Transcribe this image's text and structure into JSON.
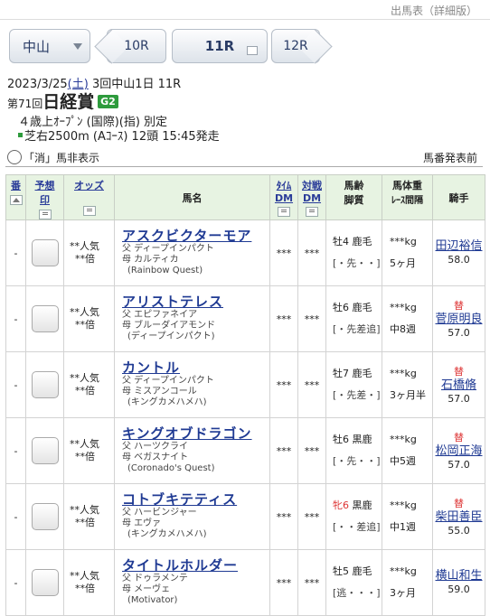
{
  "header": {
    "title": "出馬表（詳細版）"
  },
  "nav": {
    "venue": "中山",
    "prev": "10R",
    "current": "11R",
    "next": "12R"
  },
  "race": {
    "date": "2023/3/25",
    "weekday": "(土)",
    "meeting": " 3回中山1日 11R",
    "number_label": "第71回",
    "name": "日経賞",
    "grade": "G2",
    "conditions": "４歳上ｵｰﾌﾟﾝ (国際)(指) 別定",
    "course": "芝右2500m (Aｺｰｽ) 12頭 15:45発走"
  },
  "controls": {
    "hide_label": "「消」馬非表示",
    "status": "馬番発表前"
  },
  "table": {
    "headers": {
      "ban": "番",
      "mark_a": "予想",
      "mark_b": "印",
      "odds": "オッズ",
      "name": "馬名",
      "time_a": "ﾀｲﾑ",
      "time_b": "DM",
      "vs_a": "対戦",
      "vs_b": "DM",
      "age_a": "馬齢",
      "age_b": "脚質",
      "wt_a": "馬体重",
      "wt_b": "ﾚｰｽ間隔",
      "jockey": "騎手"
    },
    "rows": [
      {
        "ban": "-",
        "odds1": "**人気",
        "odds2": "**倍",
        "name": "アスクビクターモア",
        "sire": "父 ディープインパクト",
        "dam": "母 カルティカ",
        "damsire": "(Rainbow Quest)",
        "tdm": "***",
        "vdm": "***",
        "sex": "牡4",
        "coat": " 鹿毛",
        "style": "[・先・・]",
        "weight": "***kg",
        "interval": "5ヶ月",
        "change": "",
        "jockey": "田辺裕信",
        "jweight": "58.0"
      },
      {
        "ban": "-",
        "odds1": "**人気",
        "odds2": "**倍",
        "name": "アリストテレス",
        "sire": "父 エピファネイア",
        "dam": "母 ブルーダイアモンド",
        "damsire": "(ディープインパクト)",
        "tdm": "***",
        "vdm": "***",
        "sex": "牡6",
        "coat": " 鹿毛",
        "style": "[・先差追]",
        "weight": "***kg",
        "interval": "中8週",
        "change": "替",
        "jockey": "菅原明良",
        "jweight": "57.0"
      },
      {
        "ban": "-",
        "odds1": "**人気",
        "odds2": "**倍",
        "name": "カントル",
        "sire": "父 ディープインパクト",
        "dam": "母 ミスアンコール",
        "damsire": "(キングカメハメハ)",
        "tdm": "***",
        "vdm": "***",
        "sex": "牡7",
        "coat": " 鹿毛",
        "style": "[・先差・]",
        "weight": "***kg",
        "interval": "3ヶ月半",
        "change": "替",
        "jockey": "石橋脩",
        "jweight": "57.0"
      },
      {
        "ban": "-",
        "odds1": "**人気",
        "odds2": "**倍",
        "name": "キングオブドラゴン",
        "sire": "父 ハーツクライ",
        "dam": "母 ベガスナイト",
        "damsire": "(Coronado's Quest)",
        "tdm": "***",
        "vdm": "***",
        "sex": "牡6",
        "coat": " 黒鹿",
        "style": "[・先・・]",
        "weight": "***kg",
        "interval": "中5週",
        "change": "替",
        "jockey": "松岡正海",
        "jweight": "57.0"
      },
      {
        "ban": "-",
        "odds1": "**人気",
        "odds2": "**倍",
        "name": "コトブキテティス",
        "sire": "父 ハービンジャー",
        "dam": "母 エヴァ",
        "damsire": "(キングカメハメハ)",
        "tdm": "***",
        "vdm": "***",
        "sex": "牝6",
        "coat": " 黒鹿",
        "style": "[・・差追]",
        "weight": "***kg",
        "interval": "中1週",
        "change": "替",
        "jockey": "柴田善臣",
        "jweight": "55.0",
        "female": true
      },
      {
        "ban": "-",
        "odds1": "**人気",
        "odds2": "**倍",
        "name": "タイトルホルダー",
        "sire": "父 ドゥラメンテ",
        "dam": "母 メーヴェ",
        "damsire": "(Motivator)",
        "tdm": "***",
        "vdm": "***",
        "sex": "牡5",
        "coat": " 鹿毛",
        "style": "[逃・・・]",
        "weight": "***kg",
        "interval": "3ヶ月",
        "change": "",
        "jockey": "横山和生",
        "jweight": "59.0"
      }
    ]
  }
}
